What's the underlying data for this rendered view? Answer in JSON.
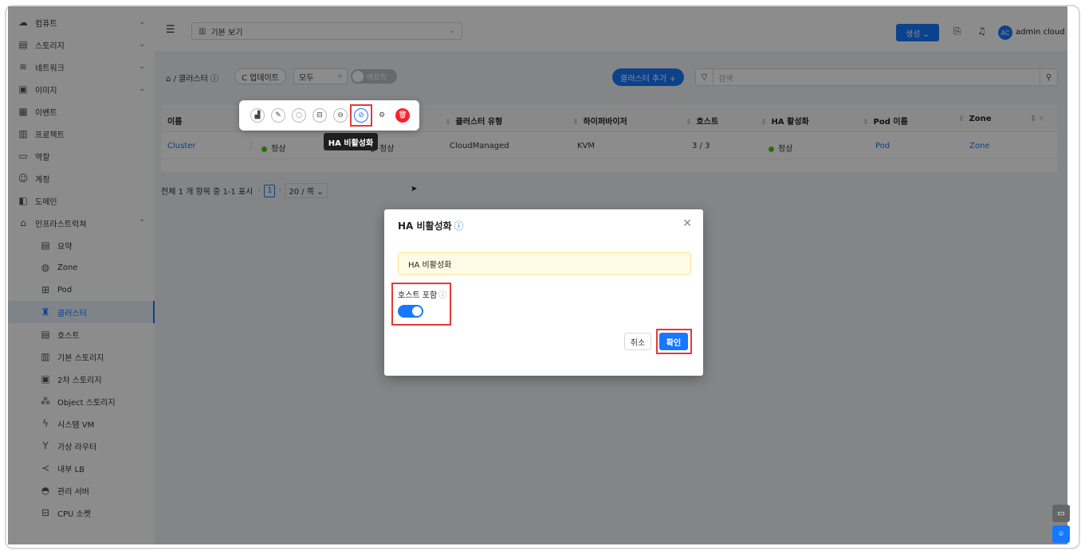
{
  "sidebar": {
    "items": [
      {
        "label": "컴퓨트",
        "icon": "cloud-icon",
        "chev": "⌄"
      },
      {
        "label": "스토리지",
        "icon": "storage-icon",
        "chev": "⌄"
      },
      {
        "label": "네트워크",
        "icon": "wifi-icon",
        "chev": "⌄"
      },
      {
        "label": "이미지",
        "icon": "image-icon",
        "chev": "⌄"
      },
      {
        "label": "이벤트",
        "icon": "calendar-icon"
      },
      {
        "label": "프로젝트",
        "icon": "project-icon"
      },
      {
        "label": "역할",
        "icon": "idcard-icon"
      },
      {
        "label": "계정",
        "icon": "users-icon"
      },
      {
        "label": "도메인",
        "icon": "domain-icon"
      },
      {
        "label": "인프라스트럭쳐",
        "icon": "bank-icon",
        "chev": "⌃"
      }
    ],
    "subitems": [
      {
        "label": "요약",
        "icon": "summary-icon"
      },
      {
        "label": "Zone",
        "icon": "globe-icon"
      },
      {
        "label": "Pod",
        "icon": "appstore-icon"
      },
      {
        "label": "클러스터",
        "icon": "cluster-icon",
        "active": true
      },
      {
        "label": "호스트",
        "icon": "host-icon"
      },
      {
        "label": "기본 스토리지",
        "icon": "database-icon"
      },
      {
        "label": "2차 스토리지",
        "icon": "picture-icon"
      },
      {
        "label": "Object 스토리지",
        "icon": "gold-icon"
      },
      {
        "label": "시스템 VM",
        "icon": "thunderbolt-icon"
      },
      {
        "label": "가상 라우터",
        "icon": "fork-icon"
      },
      {
        "label": "내부 LB",
        "icon": "share-icon"
      },
      {
        "label": "관리 서버",
        "icon": "router-icon"
      },
      {
        "label": "CPU 소켓",
        "icon": "inbox-icon"
      }
    ]
  },
  "topbar": {
    "view_select": "기본 보기",
    "create_label": "생성 ⌄",
    "avatar": "AC",
    "username": "admin cloud"
  },
  "toolbar": {
    "breadcrumb": "⌂ / 클러스터 ⓘ",
    "refresh_label": "C 업데이트",
    "filter_select": "모두",
    "metrics_toggle": "메트릭",
    "add_label": "클러스터 추가 +",
    "search_placeholder": "검색"
  },
  "table": {
    "headers": [
      "이름",
      "클러스터 유형",
      "하이퍼바이저",
      "호스트",
      "HA 활성화",
      "Pod 이름",
      "Zone"
    ],
    "row": {
      "name": "Cluster",
      "state": "정상",
      "state2": "정상",
      "type": "CloudManaged",
      "hypervisor": "KVM",
      "hosts": "3 / 3",
      "ha": "정상",
      "pod": "Pod",
      "zone": "Zone"
    }
  },
  "pager": {
    "summary": "전체 1 개 항목 중 1-1 표시",
    "page": "1",
    "page_size": "20 / 쪽 ⌄"
  },
  "tooltip": "HA 비활성화",
  "modal": {
    "title": "HA 비활성화",
    "alert": "HA 비활성화",
    "field_label": "호스트 포함",
    "include_hosts": true,
    "cancel_label": "취소",
    "ok_label": "확인"
  },
  "colors": {
    "primary": "#1677ff",
    "danger": "#f5222d",
    "success": "#52c41a",
    "highlight": "#e53935"
  }
}
